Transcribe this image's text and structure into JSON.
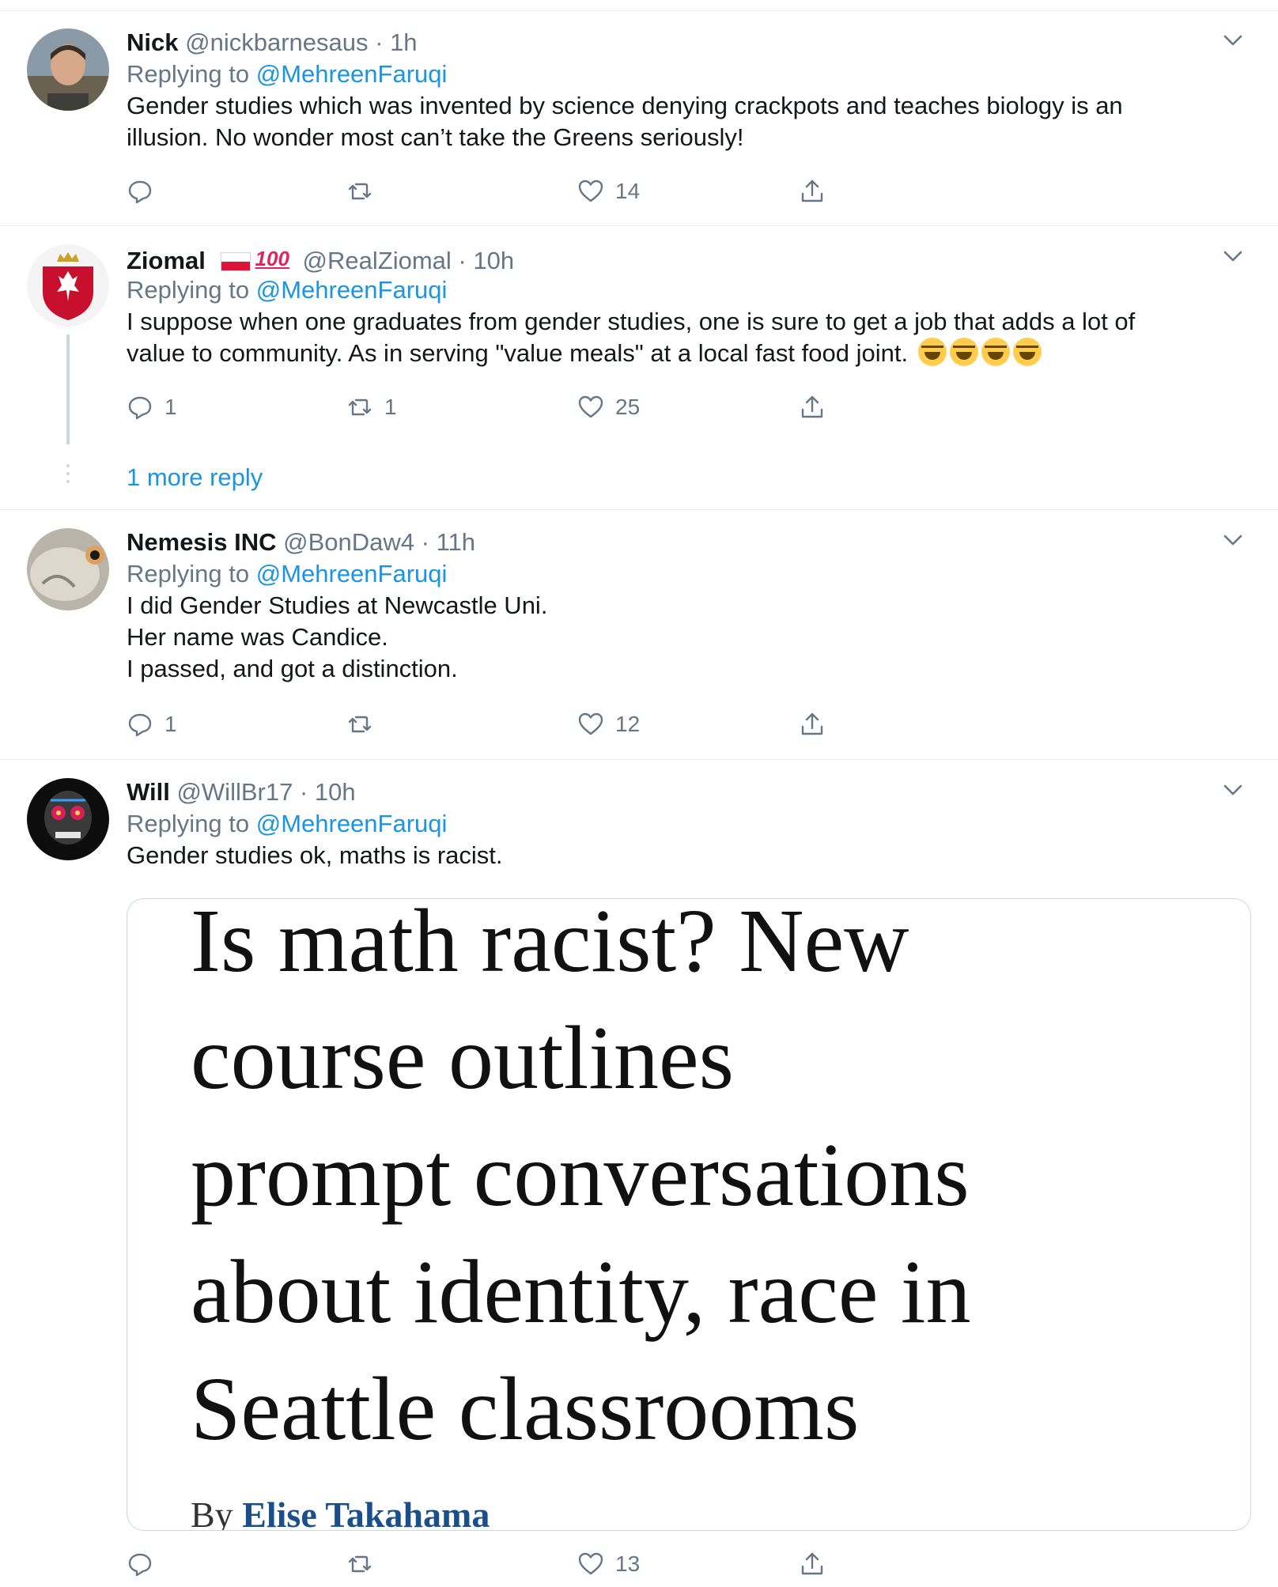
{
  "replying_to_prefix": "Replying to",
  "tweets": [
    {
      "name": "Nick",
      "handle": "@nickbarnesaus",
      "time": "1h",
      "replying_to": "@MehreenFaruqi",
      "lines": [
        "Gender studies which was invented by science denying crackpots and teaches biology is an",
        "illusion. No wonder most can’t take the Greens seriously!"
      ],
      "replies": "",
      "retweets": "",
      "likes": "14"
    },
    {
      "name": "Ziomal",
      "name_badge": "100",
      "handle": "@RealZiomal",
      "time": "10h",
      "replying_to": "@MehreenFaruqi",
      "lines": [
        "I suppose when one graduates from gender studies, one is sure to get a job that adds a lot of",
        "value to community. As in serving \"value meals\" at a local fast food joint."
      ],
      "emojis": [
        "rofl-emoji",
        "joy-emoji",
        "rofl-emoji",
        "joy-emoji"
      ],
      "replies": "1",
      "retweets": "1",
      "likes": "25",
      "more_reply": "1 more reply"
    },
    {
      "name": "Nemesis INC",
      "handle": "@BonDaw4",
      "time": "11h",
      "replying_to": "@MehreenFaruqi",
      "lines": [
        "I did Gender Studies at Newcastle Uni.",
        "Her name was Candice.",
        "I passed, and got a distinction."
      ],
      "replies": "1",
      "retweets": "",
      "likes": "12"
    },
    {
      "name": "Will",
      "handle": "@WillBr17",
      "time": "10h",
      "replying_to": "@MehreenFaruqi",
      "lines": [
        "Gender studies ok, maths is racist."
      ],
      "media": {
        "headline_lines": [
          "Is math racist? New",
          "course outlines",
          "prompt conversations",
          "about identity, race in",
          "Seattle classrooms"
        ],
        "byline_prefix": "By",
        "byline_author": "Elise Takahama"
      },
      "replies": "",
      "retweets": "",
      "likes": "13"
    }
  ],
  "colors": {
    "link": "#1b95e0",
    "muted": "#657786",
    "text": "#14171a",
    "divider": "#e6ecf0"
  }
}
